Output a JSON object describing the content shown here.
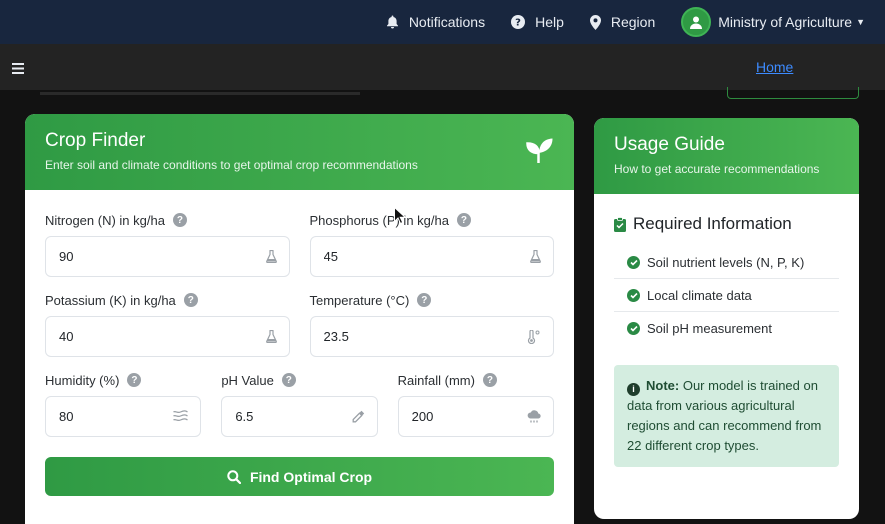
{
  "topnav": {
    "notifications_label": "Notifications",
    "help_label": "Help",
    "region_label": "Region",
    "user_label": "Ministry of Agriculture"
  },
  "breadcrumb": {
    "home_label": "Home"
  },
  "crop_finder": {
    "title": "Crop Finder",
    "subtitle": "Enter soil and climate conditions to get optimal crop recommendations",
    "fields": {
      "nitrogen": {
        "label": "Nitrogen (N) in kg/ha",
        "value": "90",
        "icon": "flask-icon"
      },
      "phosphorus": {
        "label": "Phosphorus (P) in kg/ha",
        "value": "45",
        "icon": "flask-icon"
      },
      "potassium": {
        "label": "Potassium (K) in kg/ha",
        "value": "40",
        "icon": "flask-icon"
      },
      "temperature": {
        "label": "Temperature (°C)",
        "value": "23.5",
        "icon": "thermometer-icon"
      },
      "humidity": {
        "label": "Humidity (%)",
        "value": "80",
        "icon": "water-icon"
      },
      "ph": {
        "label": "pH Value",
        "value": "6.5",
        "icon": "eyedropper-icon"
      },
      "rainfall": {
        "label": "Rainfall (mm)",
        "value": "200",
        "icon": "cloud-rain-icon"
      }
    },
    "help_glyph": "?",
    "submit_label": "Find Optimal Crop"
  },
  "usage_guide": {
    "title": "Usage Guide",
    "subtitle": "How to get accurate recommendations",
    "required_title": "Required Information",
    "items": [
      "Soil nutrient levels (N, P, K)",
      "Local climate data",
      "Soil pH measurement"
    ],
    "note_label": "Note:",
    "note_text": "Our model is trained on data from various agricultural regions and can recommend from 22 different crop types."
  },
  "colors": {
    "topnav_bg": "#18263e",
    "accent_green": "#2f9a44",
    "link_blue": "#3d8bff",
    "note_bg": "#d4ede0"
  }
}
